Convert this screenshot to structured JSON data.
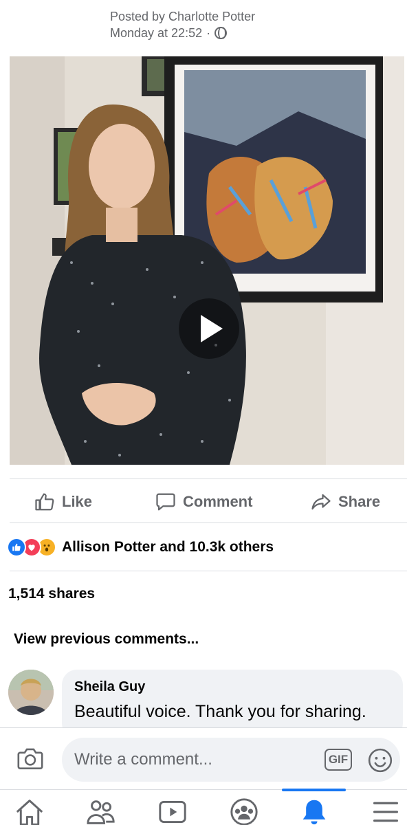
{
  "post": {
    "posted_by": "Posted by Charlotte Potter",
    "time": "Monday at 22:52",
    "separator": "·",
    "privacy_icon": "globe-icon"
  },
  "video": {
    "play_icon": "play-icon"
  },
  "actions": {
    "like": "Like",
    "comment": "Comment",
    "share": "Share"
  },
  "reactions": {
    "icons": [
      "like-reaction-icon",
      "love-reaction-icon",
      "wow-reaction-icon"
    ],
    "summary": "Allison Potter and 10.3k others"
  },
  "shares": "1,514 shares",
  "view_previous": "View previous comments...",
  "comment": {
    "author": "Sheila Guy",
    "text": "Beautiful voice. Thank you for sharing."
  },
  "composer": {
    "placeholder": "Write a comment...",
    "gif_label": "GIF"
  },
  "tabs": [
    "home-icon",
    "friends-icon",
    "watch-icon",
    "groups-icon",
    "notifications-icon",
    "menu-icon"
  ],
  "colors": {
    "accent": "#1877f2",
    "secondary_text": "#65676b",
    "bubble": "#f0f2f5"
  }
}
